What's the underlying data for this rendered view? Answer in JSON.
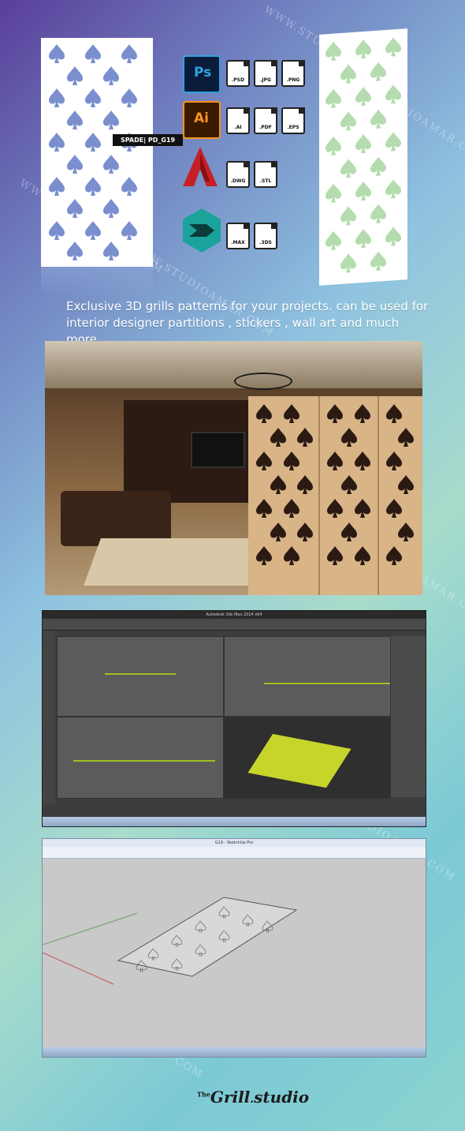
{
  "watermark": "WWW.STUDIOAMAR.COM",
  "product": {
    "tag": "SPADE| PD_G19"
  },
  "formats": {
    "photoshop": {
      "app_label": "Ps",
      "files": [
        ".PSD",
        ".JPG",
        ".PNG"
      ],
      "color": "#2fa3e0"
    },
    "illustrator": {
      "app_label": "Ai",
      "files": [
        ".AI",
        ".PDF",
        ".EPS"
      ],
      "color": "#f7941d"
    },
    "autocad": {
      "files": [
        ".DWG",
        ".STL"
      ],
      "color": "#c62027"
    },
    "max": {
      "files": [
        ".MAX",
        ".3DS"
      ],
      "color": "#1aa39a"
    }
  },
  "description": {
    "line1": "Exclusive  3D grills patterns for your projects.  can be used for",
    "line2": "interior designer partitions , stickers , wall art and much more"
  },
  "max_window": {
    "title": "Autodesk 3ds Max 2014 x64"
  },
  "sketchup_window": {
    "title": "G19 - SketchUp Pro"
  },
  "brand": {
    "prefix": "The",
    "name": "Grill",
    "suffix": "studio"
  }
}
